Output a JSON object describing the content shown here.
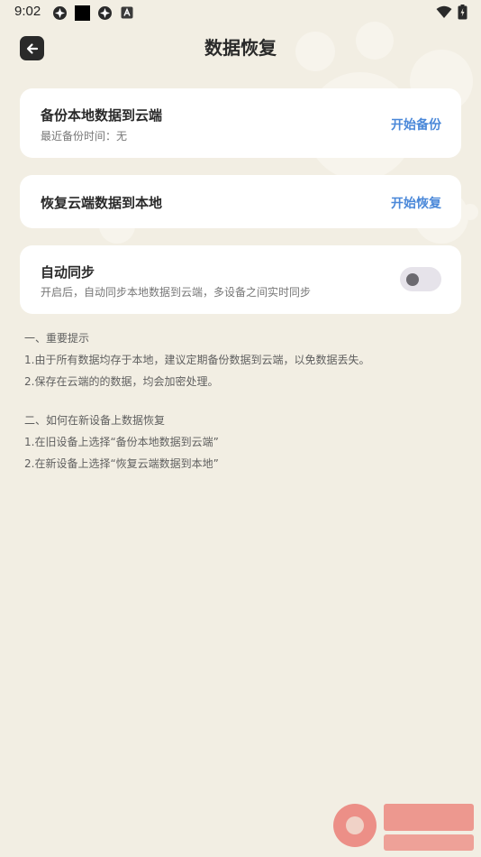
{
  "status_bar": {
    "time": "9:02"
  },
  "header": {
    "title": "数据恢复"
  },
  "cards": {
    "backup": {
      "title": "备份本地数据到云端",
      "subtitle": "最近备份时间：无",
      "action": "开始备份"
    },
    "restore": {
      "title": "恢复云端数据到本地",
      "action": "开始恢复"
    },
    "auto_sync": {
      "title": "自动同步",
      "subtitle": "开启后，自动同步本地数据到云端，多设备之间实时同步",
      "enabled": false
    }
  },
  "notes": {
    "section1_title": "一、重要提示",
    "section1_items": [
      "1.由于所有数据均存于本地，建议定期备份数据到云端，以免数据丢失。",
      "2.保存在云端的的数据，均会加密处理。"
    ],
    "section2_title": "二、如何在新设备上数据恢复",
    "section2_items": [
      "1.在旧设备上选择“备份本地数据到云端”",
      "2.在新设备上选择“恢复云端数据到本地”"
    ]
  },
  "colors": {
    "background": "#f2eee3",
    "card": "#ffffff",
    "accent": "#4a88d9",
    "back_button": "#2a2a2a"
  },
  "icons": {
    "back": "arrow-left-icon",
    "status": [
      "app-icon",
      "app-icon",
      "app-icon",
      "keyboard-icon",
      "wifi-icon",
      "battery-icon"
    ]
  }
}
